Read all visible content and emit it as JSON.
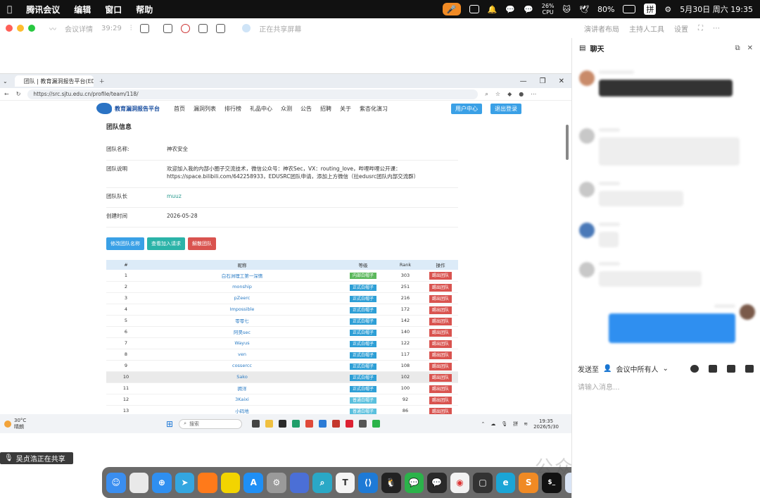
{
  "menubar": {
    "app": "腾讯会议",
    "edit": "编辑",
    "window": "窗口",
    "help": "帮助",
    "cpu_pct": "26%",
    "cpu_label": "CPU",
    "battery": "80%",
    "ime": "拼",
    "datetime": "5月30日 周六  19:35"
  },
  "meeting": {
    "details": "会议详情",
    "timer": "39:29",
    "sharing_text": "正在共享屏幕",
    "layout": "演讲者布局",
    "host_tools": "主持人工具",
    "settings": "设置"
  },
  "browser": {
    "tab_title": "团队 | 教育漏洞报告平台(EDUSRC)",
    "url": "https://src.sjtu.edu.cn/profile/team/118/"
  },
  "site": {
    "logo": "教育漏洞报告平台",
    "nav": [
      "首页",
      "漏洞列表",
      "排行榜",
      "礼品中心",
      "众测",
      "公告",
      "招聘",
      "关于",
      "紫杏化演习"
    ],
    "user_center": "用户中心",
    "logout": "退出登录"
  },
  "team": {
    "section_title": "团队信息",
    "name_label": "团队名称:",
    "name": "神农安全",
    "desc_label": "团队说明",
    "desc": "欢迎加入我的内部小圈子交流技术，微信公众号：神农Sec，VX：routing_love，哔哩哔哩公开课：https://space.bilibili.com/642258933，EDUSRC团队申请，添加上方微信（拉edusrc团队内部交流群）",
    "leader_label": "团队队长",
    "leader": "muuz",
    "date_label": "创建时间",
    "date": "2026-05-28",
    "btn_rename": "修改团队名称",
    "btn_requests": "查看加入请求",
    "btn_disband": "解散团队"
  },
  "table": {
    "headers": [
      "#",
      "昵称",
      "等级",
      "Rank",
      "操作"
    ],
    "rows": [
      {
        "n": "1",
        "name": "白石洲理工第一深情",
        "level": "内部白帽子",
        "rank": "303",
        "op": "踢出团队"
      },
      {
        "n": "2",
        "name": "monship",
        "level": "正式白帽子",
        "rank": "251",
        "op": "踢出团队"
      },
      {
        "n": "3",
        "name": "pZeerc",
        "level": "正式白帽子",
        "rank": "216",
        "op": "踢出团队"
      },
      {
        "n": "4",
        "name": "Impossible",
        "level": "正式白帽子",
        "rank": "172",
        "op": "踢出团队"
      },
      {
        "n": "5",
        "name": "零零七",
        "level": "正式白帽子",
        "rank": "142",
        "op": "踢出团队"
      },
      {
        "n": "6",
        "name": "阿昊sec",
        "level": "正式白帽子",
        "rank": "140",
        "op": "踢出团队"
      },
      {
        "n": "7",
        "name": "Wayus",
        "level": "正式白帽子",
        "rank": "122",
        "op": "踢出团队"
      },
      {
        "n": "8",
        "name": "ven",
        "level": "正式白帽子",
        "rank": "117",
        "op": "踢出团队"
      },
      {
        "n": "9",
        "name": "cossercc",
        "level": "正式白帽子",
        "rank": "108",
        "op": "踢出团队"
      },
      {
        "n": "10",
        "name": "Sako",
        "level": "正式白帽子",
        "rank": "102",
        "op": "踢出团队"
      },
      {
        "n": "11",
        "name": "拥洋",
        "level": "正式白帽子",
        "rank": "100",
        "op": "踢出团队"
      },
      {
        "n": "12",
        "name": "3Kaixi",
        "level": "普通白帽子",
        "rank": "92",
        "op": "踢出团队"
      },
      {
        "n": "13",
        "name": "小码地",
        "level": "普通白帽子",
        "rank": "86",
        "op": "踢出团队"
      },
      {
        "n": "14",
        "name": "Sweet_Soup",
        "level": "普通白帽子",
        "rank": "83",
        "op": "踢出团队"
      }
    ]
  },
  "taskbar": {
    "temp": "30°C",
    "weather": "晴朗",
    "search": "搜索",
    "ime": "拼",
    "time": "19:35",
    "date": "2026/5/30"
  },
  "sharebadge": "吴贞浩正在共享",
  "watermark": "公众号 · 神农Sec",
  "chat": {
    "title": "聊天",
    "send_to_label": "发送至",
    "send_to_target": "会议中所有人",
    "placeholder": "请输入消息..."
  },
  "colors": {
    "tag_internal": "#5cb85c",
    "tag_formal": "#2e9fd6",
    "tag_normal": "#5bc0de",
    "kick": "#d9534f",
    "btn_blue": "#3aa0e6",
    "btn_teal": "#2bb3a8",
    "btn_red": "#d9534f"
  }
}
